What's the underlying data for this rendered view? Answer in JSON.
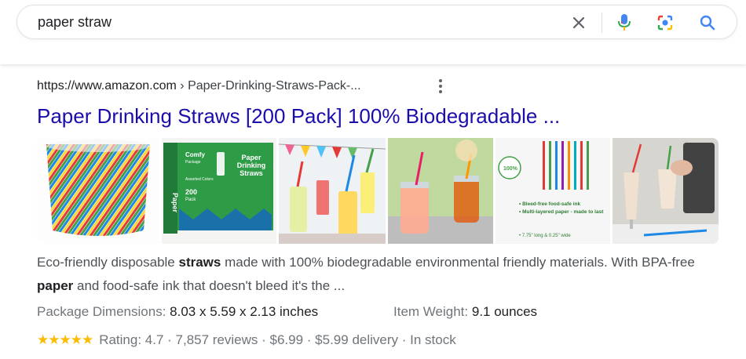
{
  "search": {
    "query": "paper straw"
  },
  "result": {
    "url_domain": "https://www.amazon.com",
    "url_path": " › Paper-Drinking-Straws-Pack-...",
    "title": "Paper Drinking Straws [200 Pack] 100% Biodegradable ...",
    "snippet_parts": [
      "Eco-friendly disposable ",
      "straws",
      " made with 100% biodegradable environmental friendly materials. With BPA-free ",
      "paper",
      " and food-safe ink that doesn't bleed it's the ..."
    ],
    "facts": [
      {
        "label": "Package Dimensions:",
        "value": "8.03 x 5.59 x 2.13 inches"
      },
      {
        "label": "Item Weight:",
        "value": "9.1 ounces"
      }
    ],
    "rating_value": 4.7,
    "rating_text": "Rating: 4.7 · 7,857 reviews · $6.99 · $5.99 delivery · In stock",
    "stars": "★★★★★"
  },
  "images": {
    "box_brand": "Comfy",
    "box_brand_sub": "Package",
    "box_title": "Paper Drinking Straws",
    "box_side": "Paper",
    "box_count": "200",
    "box_count_unit": "Pack",
    "box_colors": "Assorted Colors",
    "badge": "100%",
    "features": [
      "• Bleed-free food-safe ink",
      "• Multi-layered paper - made to last",
      "• 7.75\" long & 0.25\" wide"
    ]
  },
  "colors": {
    "link": "#1a0dab",
    "star": "#fbbc04",
    "box_green": "#2e9b47"
  }
}
